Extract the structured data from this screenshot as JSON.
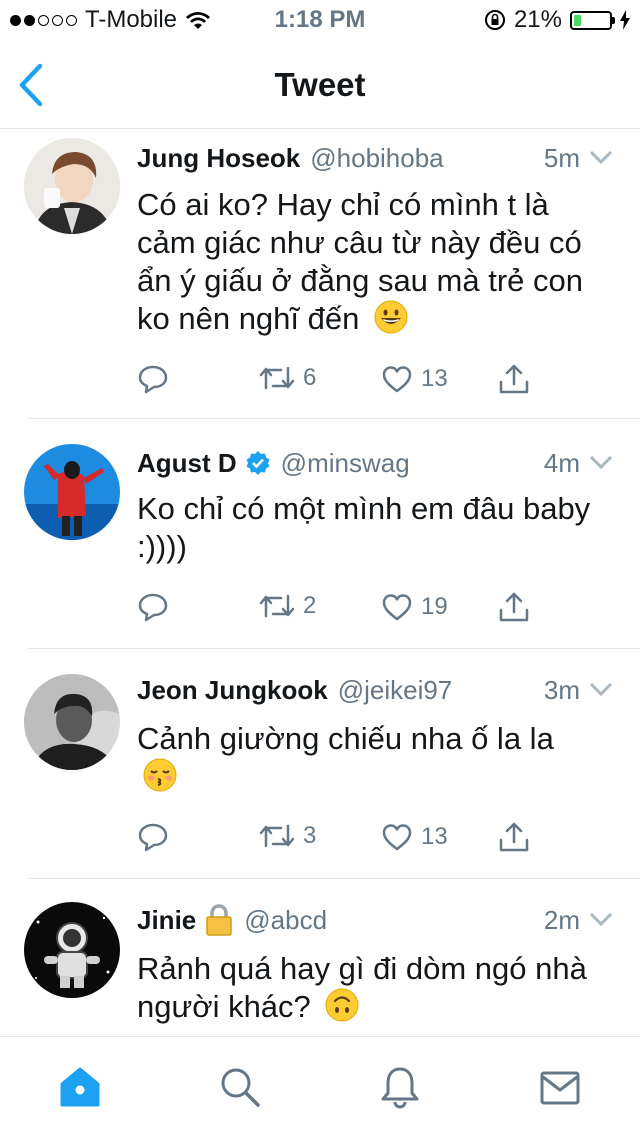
{
  "status_bar": {
    "carrier": "T-Mobile",
    "time": "1:18 PM",
    "battery": "21%",
    "battery_level": 0.21,
    "signal_bars": 2
  },
  "nav": {
    "title": "Tweet",
    "back_icon": "chevron-left-icon"
  },
  "tweets": [
    {
      "name": "Jung Hoseok",
      "handle": "@hobihoba",
      "time": "5m",
      "text": "Có ai ko? Hay chỉ có mình t là cảm giác như câu từ này đều có ẩn ý giấu ở đằng sau mà trẻ con ko nên nghĩ đến",
      "emoji": "grinning-face",
      "retweets": "6",
      "likes": "13"
    },
    {
      "name": "Agust D",
      "handle": "@minswag",
      "time": "4m",
      "verified": true,
      "text": "Ko chỉ có một mình em đâu baby :))))",
      "retweets": "2",
      "likes": "19"
    },
    {
      "name": "Jeon Jungkook",
      "handle": "@jeikei97",
      "time": "3m",
      "text": "Cảnh giường chiếu nha ố la la",
      "emoji": "kissing-face-closed-eyes",
      "retweets": "3",
      "likes": "13"
    },
    {
      "name": "Jinie",
      "handle": "@abcd",
      "time": "2m",
      "locked": true,
      "text": "Rảnh quá hay gì đi dòm ngó nhà người khác?",
      "emoji": "upside-down-face"
    }
  ],
  "tabs": [
    "home-icon",
    "search-icon",
    "notifications-icon",
    "messages-icon"
  ],
  "colors": {
    "accent": "#1da1f2",
    "secondary_text": "#657786",
    "divider": "#e1e8ed"
  }
}
